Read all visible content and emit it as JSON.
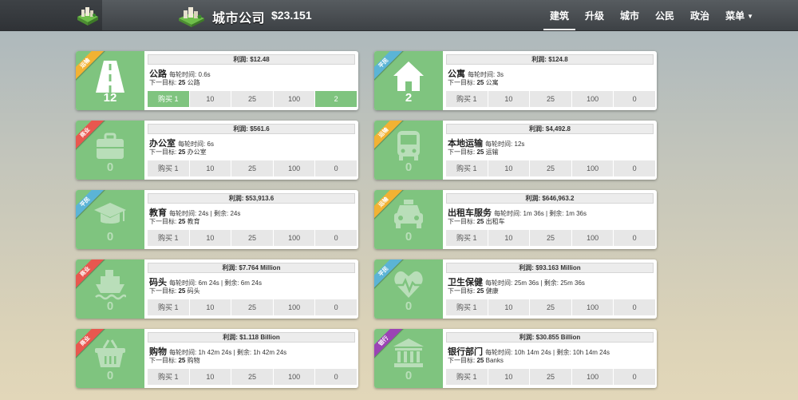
{
  "app": {
    "brand": "城市公司",
    "money": "$23.151"
  },
  "nav": {
    "items": [
      {
        "label": "建筑",
        "active": true
      },
      {
        "label": "升级",
        "active": false
      },
      {
        "label": "城市",
        "active": false
      },
      {
        "label": "公民",
        "active": false
      },
      {
        "label": "政治",
        "active": false
      },
      {
        "label": "菜单",
        "active": false,
        "dropdown": true
      }
    ]
  },
  "labels": {
    "interval": "每轮时间:",
    "next_goal": "下一目标:"
  },
  "buildings": [
    {
      "name": "公路",
      "profit": "利润: $12.48",
      "time": "0.6s",
      "remaining": "",
      "next_count": "25",
      "next_unit": "公路",
      "count": "12",
      "ribbon": "运输",
      "ribbon_color": "#f2b233",
      "icon": "road-icon",
      "buy": [
        "购买 1",
        "10",
        "25",
        "100",
        "2"
      ],
      "buy_active": [
        true,
        false,
        false,
        false,
        true
      ]
    },
    {
      "name": "公寓",
      "profit": "利润: $124.8",
      "time": "3s",
      "remaining": "",
      "next_count": "25",
      "next_unit": "公寓",
      "count": "2",
      "ribbon": "平民",
      "ribbon_color": "#5bb4d6",
      "icon": "house-icon",
      "buy": [
        "购买 1",
        "10",
        "25",
        "100",
        "0"
      ],
      "buy_active": [
        false,
        false,
        false,
        false,
        false
      ]
    },
    {
      "name": "办公室",
      "profit": "利润: $561.6",
      "time": "6s",
      "remaining": "",
      "next_count": "25",
      "next_unit": "办公室",
      "count": "0",
      "ribbon": "商业",
      "ribbon_color": "#e8574f",
      "icon": "briefcase-icon",
      "buy": [
        "购买 1",
        "10",
        "25",
        "100",
        "0"
      ],
      "buy_active": [
        false,
        false,
        false,
        false,
        false
      ]
    },
    {
      "name": "本地运输",
      "profit": "利润: $4,492.8",
      "time": "12s",
      "remaining": "",
      "next_count": "25",
      "next_unit": "运输",
      "count": "0",
      "ribbon": "运输",
      "ribbon_color": "#f2b233",
      "icon": "bus-icon",
      "buy": [
        "购买 1",
        "10",
        "25",
        "100",
        "0"
      ],
      "buy_active": [
        false,
        false,
        false,
        false,
        false
      ]
    },
    {
      "name": "教育",
      "profit": "利润: $53,913.6",
      "time": "24s",
      "remaining": "24s",
      "next_count": "25",
      "next_unit": "教育",
      "count": "0",
      "ribbon": "平民",
      "ribbon_color": "#5bb4d6",
      "icon": "graduation-cap-icon",
      "buy": [
        "购买 1",
        "10",
        "25",
        "100",
        "0"
      ],
      "buy_active": [
        false,
        false,
        false,
        false,
        false
      ]
    },
    {
      "name": "出租车服务",
      "profit": "利润: $646,963.2",
      "time": "1m 36s",
      "remaining": "1m 36s",
      "next_count": "25",
      "next_unit": "出租车",
      "count": "0",
      "ribbon": "运输",
      "ribbon_color": "#f2b233",
      "icon": "taxi-icon",
      "buy": [
        "购买 1",
        "10",
        "25",
        "100",
        "0"
      ],
      "buy_active": [
        false,
        false,
        false,
        false,
        false
      ]
    },
    {
      "name": "码头",
      "profit": "利润: $7.764 Million",
      "time": "6m 24s",
      "remaining": "6m 24s",
      "next_count": "25",
      "next_unit": "码头",
      "count": "0",
      "ribbon": "商业",
      "ribbon_color": "#e8574f",
      "icon": "ship-icon",
      "buy": [
        "购买 1",
        "10",
        "25",
        "100",
        "0"
      ],
      "buy_active": [
        false,
        false,
        false,
        false,
        false
      ]
    },
    {
      "name": "卫生保健",
      "profit": "利润: $93.163 Million",
      "time": "25m 36s",
      "remaining": "25m 36s",
      "next_count": "25",
      "next_unit": "健康",
      "count": "0",
      "ribbon": "平民",
      "ribbon_color": "#5bb4d6",
      "icon": "heartbeat-icon",
      "buy": [
        "购买 1",
        "10",
        "25",
        "100",
        "0"
      ],
      "buy_active": [
        false,
        false,
        false,
        false,
        false
      ]
    },
    {
      "name": "购物",
      "profit": "利润: $1.118 Billion",
      "time": "1h 42m 24s",
      "remaining": "1h 42m 24s",
      "next_count": "25",
      "next_unit": "购物",
      "count": "0",
      "ribbon": "商业",
      "ribbon_color": "#e8574f",
      "icon": "basket-icon",
      "buy": [
        "购买 1",
        "10",
        "25",
        "100",
        "0"
      ],
      "buy_active": [
        false,
        false,
        false,
        false,
        false
      ]
    },
    {
      "name": "银行部门",
      "profit": "利润: $30.855 Billion",
      "time": "10h 14m 24s",
      "remaining": "10h 14m 24s",
      "next_count": "25",
      "next_unit": "Banks",
      "count": "0",
      "ribbon": "银行",
      "ribbon_color": "#9b43b5",
      "icon": "bank-icon",
      "buy": [
        "购买 1",
        "10",
        "25",
        "100",
        "0"
      ],
      "buy_active": [
        false,
        false,
        false,
        false,
        false
      ]
    }
  ],
  "remaining_label": "剩余:"
}
